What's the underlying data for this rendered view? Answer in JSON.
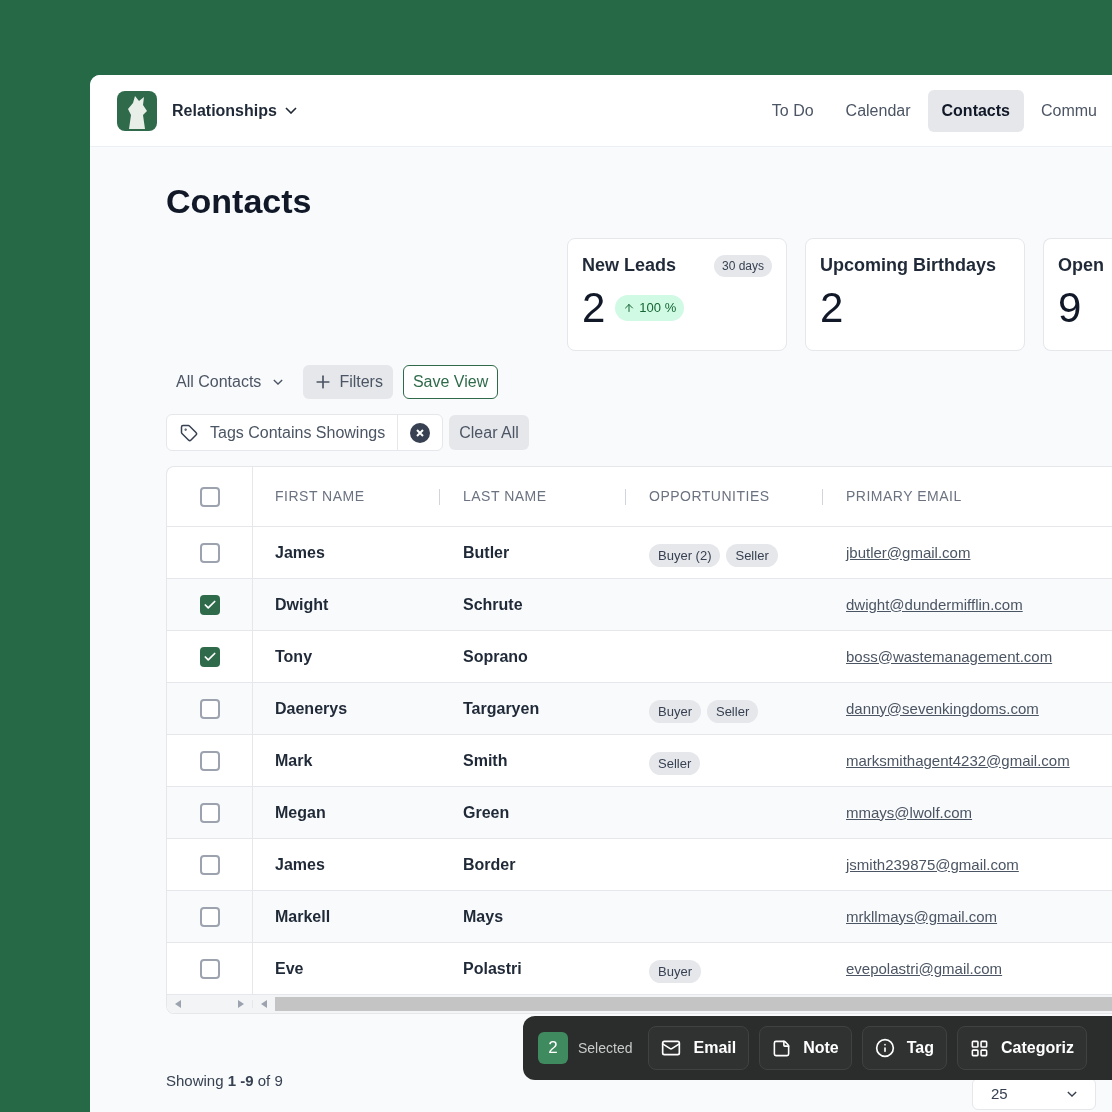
{
  "app": {
    "title": "Relationships"
  },
  "nav": [
    {
      "label": "To Do",
      "selected": false
    },
    {
      "label": "Calendar",
      "selected": false
    },
    {
      "label": "Contacts",
      "selected": true
    },
    {
      "label": "Commu",
      "selected": false
    }
  ],
  "page_title": "Contacts",
  "stats": [
    {
      "title": "New Leads",
      "period": "30 days",
      "value": "2",
      "change": "100 %"
    },
    {
      "title": "Upcoming Birthdays",
      "value": "2"
    },
    {
      "title": "Open",
      "value": "9"
    }
  ],
  "view": {
    "label": "All Contacts"
  },
  "filters_button": "Filters",
  "save_view_button": "Save View",
  "filter_chips": [
    {
      "label": "Tags Contains Showings"
    }
  ],
  "clear_all_button": "Clear All",
  "table": {
    "select_all_checked": false,
    "columns": [
      "FIRST NAME",
      "LAST NAME",
      "OPPORTUNITIES",
      "PRIMARY EMAIL"
    ],
    "rows": [
      {
        "checked": false,
        "first_name": "James",
        "last_name": "Butler",
        "opportunities": [
          "Buyer (2)",
          "Seller"
        ],
        "email": "jbutler@gmail.com"
      },
      {
        "checked": true,
        "first_name": "Dwight",
        "last_name": "Schrute",
        "opportunities": [],
        "email": "dwight@dundermifflin.com"
      },
      {
        "checked": true,
        "first_name": "Tony",
        "last_name": "Soprano",
        "opportunities": [],
        "email": "boss@wastemanagement.com"
      },
      {
        "checked": false,
        "first_name": "Daenerys",
        "last_name": "Targaryen",
        "opportunities": [
          "Buyer",
          "Seller"
        ],
        "email": "danny@sevenkingdoms.com"
      },
      {
        "checked": false,
        "first_name": "Mark",
        "last_name": "Smith",
        "opportunities": [
          "Seller"
        ],
        "email": "marksmithagent4232@gmail.com"
      },
      {
        "checked": false,
        "first_name": "Megan",
        "last_name": "Green",
        "opportunities": [],
        "email": "mmays@lwolf.com"
      },
      {
        "checked": false,
        "first_name": "James",
        "last_name": "Border",
        "opportunities": [],
        "email": "jsmith239875@gmail.com"
      },
      {
        "checked": false,
        "first_name": "Markell",
        "last_name": "Mays",
        "opportunities": [],
        "email": "mrkllmays@gmail.com"
      },
      {
        "checked": false,
        "first_name": "Eve",
        "last_name": "Polastri",
        "opportunities": [
          "Buyer"
        ],
        "email": "evepolastri@gmail.com"
      }
    ]
  },
  "footer": {
    "showing": "Showing **1 -9** of 9",
    "page_size": "25"
  },
  "bulk_bar": {
    "count": "2",
    "label": "Selected",
    "actions": [
      {
        "kind": "email",
        "label": "Email"
      },
      {
        "kind": "note",
        "label": "Note"
      },
      {
        "kind": "tag",
        "label": "Tag"
      },
      {
        "kind": "categorize",
        "label": "Categoriz"
      }
    ]
  }
}
